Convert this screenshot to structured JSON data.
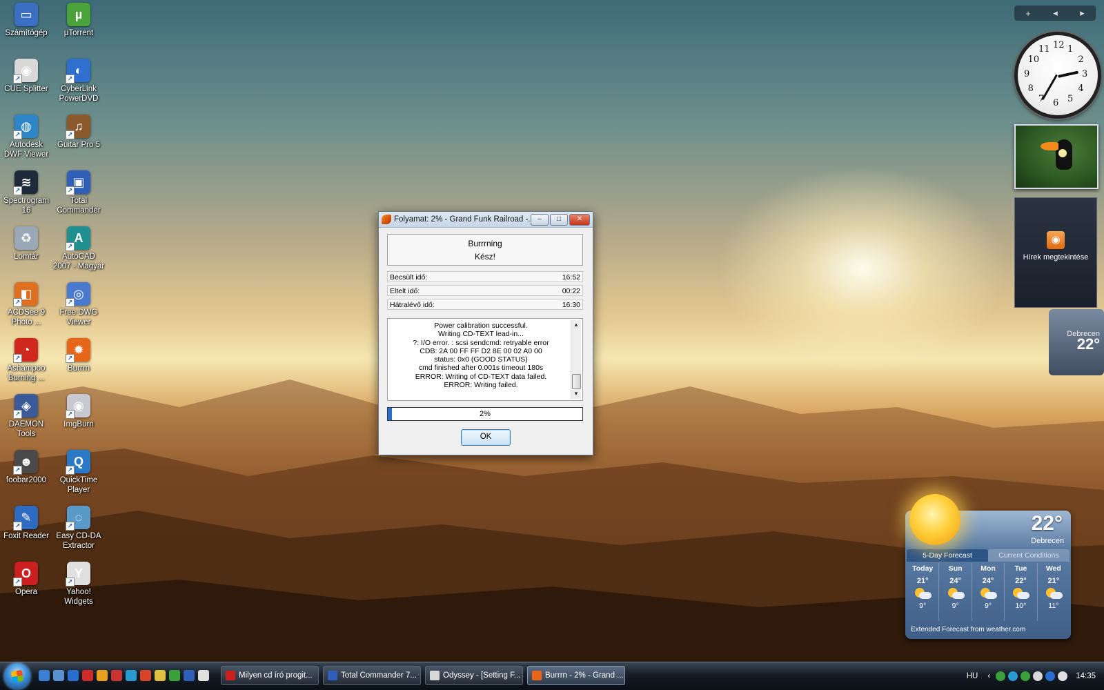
{
  "desktop_icons": [
    {
      "label": "Számítógép",
      "color": "#3b6fc4",
      "glyph": "▭"
    },
    {
      "label": "µTorrent",
      "color": "#4aa33a",
      "glyph": "µ"
    },
    {
      "label": "CUE Splitter",
      "color": "#d8d8d8",
      "glyph": "◉"
    },
    {
      "label": "CyberLink PowerDVD",
      "color": "#2f6fd0",
      "glyph": "◐"
    },
    {
      "label": "Autodesk DWF Viewer",
      "color": "#2e86c8",
      "glyph": "◍"
    },
    {
      "label": "Guitar Pro 5",
      "color": "#8a5a2c",
      "glyph": "♫"
    },
    {
      "label": "Spectrogram 16",
      "color": "#1e2a3a",
      "glyph": "≋"
    },
    {
      "label": "Total Commander",
      "color": "#2f5fb8",
      "glyph": "▣"
    },
    {
      "label": "Lomtár",
      "color": "#9aa8b8",
      "glyph": "♻"
    },
    {
      "label": "AutoCAD 2007 - Magyar",
      "color": "#1f8f8f",
      "glyph": "A"
    },
    {
      "label": "ACDSee 9 Photo ...",
      "color": "#e07020",
      "glyph": "◧"
    },
    {
      "label": "Free DWG Viewer",
      "color": "#4a7ad0",
      "glyph": "◎"
    },
    {
      "label": "Ashampoo Burning ...",
      "color": "#d0281c",
      "glyph": "◔"
    },
    {
      "label": "Burrrn",
      "color": "#e8661a",
      "glyph": "✹"
    },
    {
      "label": "DAEMON Tools",
      "color": "#3a5a9a",
      "glyph": "◈"
    },
    {
      "label": "ImgBurn",
      "color": "#c8c8d0",
      "glyph": "◉"
    },
    {
      "label": "foobar2000",
      "color": "#4a4a4a",
      "glyph": "☻"
    },
    {
      "label": "QuickTime Player",
      "color": "#2a7ac8",
      "glyph": "Q"
    },
    {
      "label": "Foxit Reader",
      "color": "#2d6bc2",
      "glyph": "✎"
    },
    {
      "label": "Easy CD-DA Extractor",
      "color": "#5a9ac8",
      "glyph": "◌"
    },
    {
      "label": "Opera",
      "color": "#cc1f1f",
      "glyph": "O"
    },
    {
      "label": "Yahoo! Widgets",
      "color": "#e0e0e0",
      "glyph": "Y"
    }
  ],
  "sidebar": {
    "controls": [
      "+",
      "◂",
      "▸"
    ],
    "feed_label": "Hírek megtekintése",
    "mini_weather": {
      "city": "Debrecen",
      "temp": "22°"
    }
  },
  "clock": {
    "numbers": [
      "12",
      "1",
      "2",
      "3",
      "4",
      "5",
      "6",
      "7",
      "8",
      "9",
      "10",
      "11"
    ],
    "time": "14:35"
  },
  "weather": {
    "temp": "22°",
    "city": "Debrecen",
    "tabs": [
      "5-Day Forecast",
      "Current Conditions"
    ],
    "days": [
      {
        "name": "Today",
        "hi": "21°",
        "lo": "9°"
      },
      {
        "name": "Sun",
        "hi": "24°",
        "lo": "9°"
      },
      {
        "name": "Mon",
        "hi": "24°",
        "lo": "9°"
      },
      {
        "name": "Tue",
        "hi": "22°",
        "lo": "10°"
      },
      {
        "name": "Wed",
        "hi": "21°",
        "lo": "11°"
      }
    ],
    "footer": "Extended Forecast from weather.com"
  },
  "dialog": {
    "title": "Folyamat: 2% - Grand Funk Railroad -...",
    "status_line1": "Burrrning",
    "status_line2": "Kész!",
    "rows": [
      {
        "label": "Becsült idő:",
        "value": "16:52"
      },
      {
        "label": "Eltelt idő:",
        "value": "00:22"
      },
      {
        "label": "Hátralévő idő:",
        "value": "16:30"
      }
    ],
    "log": [
      "Power calibration successful.",
      "Writing CD-TEXT lead-in...",
      "?: I/O error.  : scsi sendcmd: retryable error",
      "CDB:  2A 00 FF FF D2 8E 00 02 A0 00",
      "status: 0x0 (GOOD STATUS)",
      "cmd finished after 0.001s timeout 180s",
      "ERROR: Writing of CD-TEXT data failed.",
      "ERROR: Writing failed."
    ],
    "progress_percent": 2,
    "progress_label": "2%",
    "ok_label": "OK"
  },
  "taskbar": {
    "quicklaunch_colors": [
      "#3a7fd0",
      "#5a8fd0",
      "#2a6fd0",
      "#d02a2a",
      "#e8a020",
      "#cc3333",
      "#2a9ad0",
      "#d8442a",
      "#e0c040",
      "#3aa03a",
      "#2f5fb8",
      "#e0e0e0"
    ],
    "tasks": [
      {
        "label": "Milyen cd író progit...",
        "color": "#cc1f1f",
        "active": false
      },
      {
        "label": "Total Commander 7...",
        "color": "#2f5fb8",
        "active": false
      },
      {
        "label": "Odyssey - [Setting F...",
        "color": "#d8d8d8",
        "active": false
      },
      {
        "label": "Burrrn - 2% - Grand ...",
        "color": "#e8661a",
        "active": true
      }
    ],
    "lang": "HU",
    "tray_arrow": "‹",
    "tray_colors": [
      "#3aa03a",
      "#2a9ad0",
      "#3aa03a",
      "#d8d8d8",
      "#2a6fd0",
      "#e0e0e0"
    ],
    "clock": "14:35"
  }
}
